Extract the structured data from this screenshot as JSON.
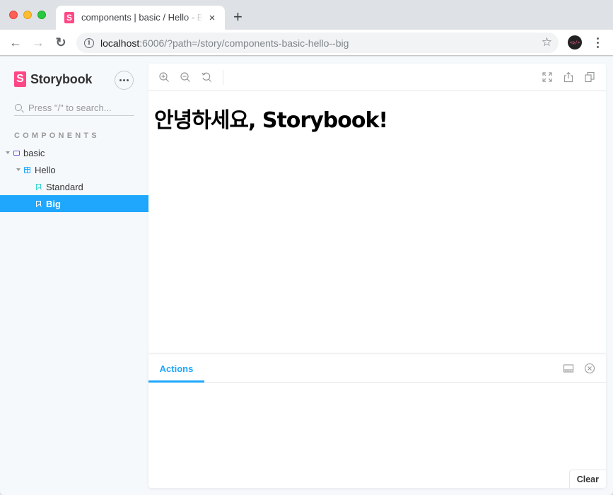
{
  "browser": {
    "tab": {
      "favicon": "S",
      "title": "components | basic / Hello - Big ⋅ Storybook",
      "close_icon": "×"
    },
    "new_tab_icon": "+",
    "nav": {
      "back_icon": "←",
      "forward_icon": "→",
      "reload_icon": "↻"
    },
    "address": {
      "info_icon": "i",
      "host": "localhost",
      "rest": ":6006/?path=/story/components-basic-hello--big"
    },
    "star_icon": "☆",
    "avatar_text": "<p/>"
  },
  "sidebar": {
    "logo_letter": "S",
    "brand": "Storybook",
    "search_placeholder": "Press \"/\" to search...",
    "section_title": "COMPONENTS",
    "tree": [
      {
        "label": "basic",
        "type": "folder",
        "level": 0,
        "expanded": true
      },
      {
        "label": "Hello",
        "type": "component",
        "level": 1,
        "expanded": true
      },
      {
        "label": "Standard",
        "type": "story",
        "level": 2,
        "selected": false
      },
      {
        "label": "Big",
        "type": "story",
        "level": 2,
        "selected": true
      }
    ]
  },
  "preview": {
    "tools": [
      "zoom-in",
      "zoom-out",
      "zoom-reset",
      "fullscreen",
      "open-new-tab",
      "copy-link"
    ],
    "heading": "안녕하세요, Storybook!"
  },
  "addons": {
    "active_tab": "Actions",
    "clear_label": "Clear"
  },
  "colors": {
    "accent": "#1ea7fd",
    "brand": "#ff4785",
    "folder": "#774dd7",
    "story": "#37d5d3"
  }
}
